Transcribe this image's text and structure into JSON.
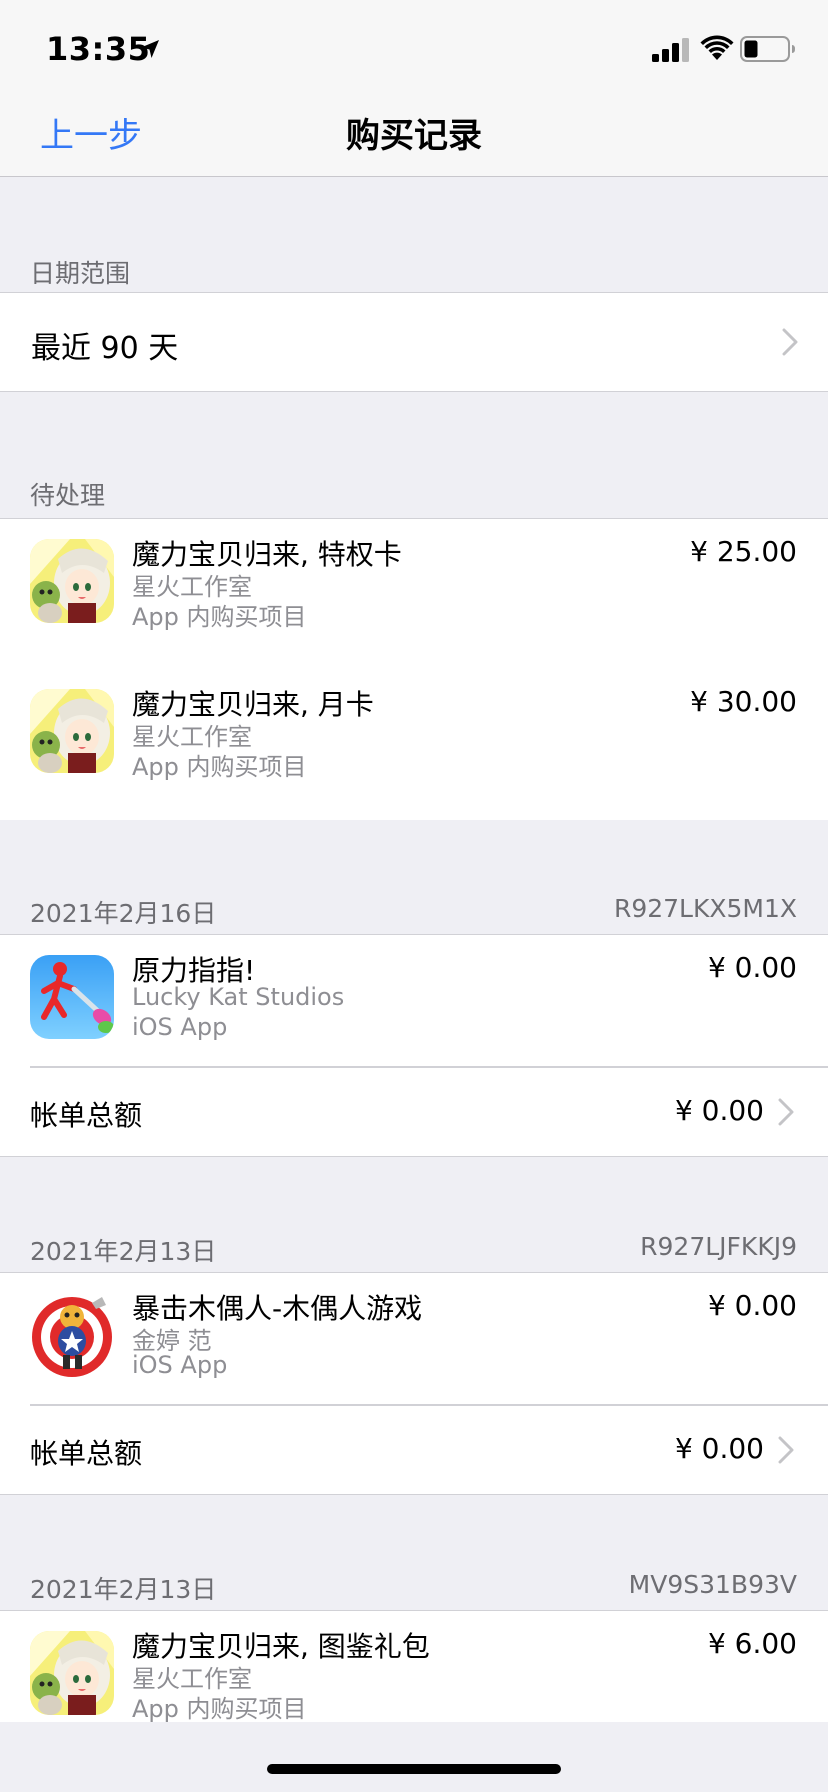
{
  "status_bar": {
    "time": "13:35",
    "icons": [
      "location-arrow-icon",
      "cellular-signal-icon",
      "wifi-icon",
      "battery-icon"
    ]
  },
  "nav": {
    "back_label": "上一步",
    "title": "购买记录",
    "accent_color": "#3478f6"
  },
  "date_range": {
    "header": "日期范围",
    "value": "最近 90 天"
  },
  "pending": {
    "header": "待处理",
    "items": [
      {
        "title": "魔力宝贝归来, 特权卡",
        "developer": "星火工作室",
        "type": "App 内购买项目",
        "price": "¥ 25.00",
        "icon": "anime-girl-app-icon"
      },
      {
        "title": "魔力宝贝归来, 月卡",
        "developer": "星火工作室",
        "type": "App 内购买项目",
        "price": "¥ 30.00",
        "icon": "anime-girl-app-icon"
      }
    ]
  },
  "orders": [
    {
      "date": "2021年2月16日",
      "order_id": "R927LKX5M1X",
      "items": [
        {
          "title": "原力指指!",
          "developer": "Lucky Kat Studios",
          "type": "iOS App",
          "price": "¥ 0.00",
          "icon": "stickman-app-icon"
        }
      ],
      "total_label": "帐单总额",
      "total_value": "¥ 0.00"
    },
    {
      "date": "2021年2月13日",
      "order_id": "R927LJFKKJ9",
      "items": [
        {
          "title": "暴击木偶人-木偶人游戏",
          "developer": "金婷 范",
          "type": "iOS App",
          "price": "¥ 0.00",
          "icon": "puppet-target-app-icon"
        }
      ],
      "total_label": "帐单总额",
      "total_value": "¥ 0.00"
    },
    {
      "date": "2021年2月13日",
      "order_id": "MV9S31B93V",
      "items": [
        {
          "title": "魔力宝贝归来, 图鉴礼包",
          "developer": "星火工作室",
          "type": "App 内购买项目",
          "price": "¥ 6.00",
          "icon": "anime-girl-app-icon"
        }
      ]
    }
  ]
}
